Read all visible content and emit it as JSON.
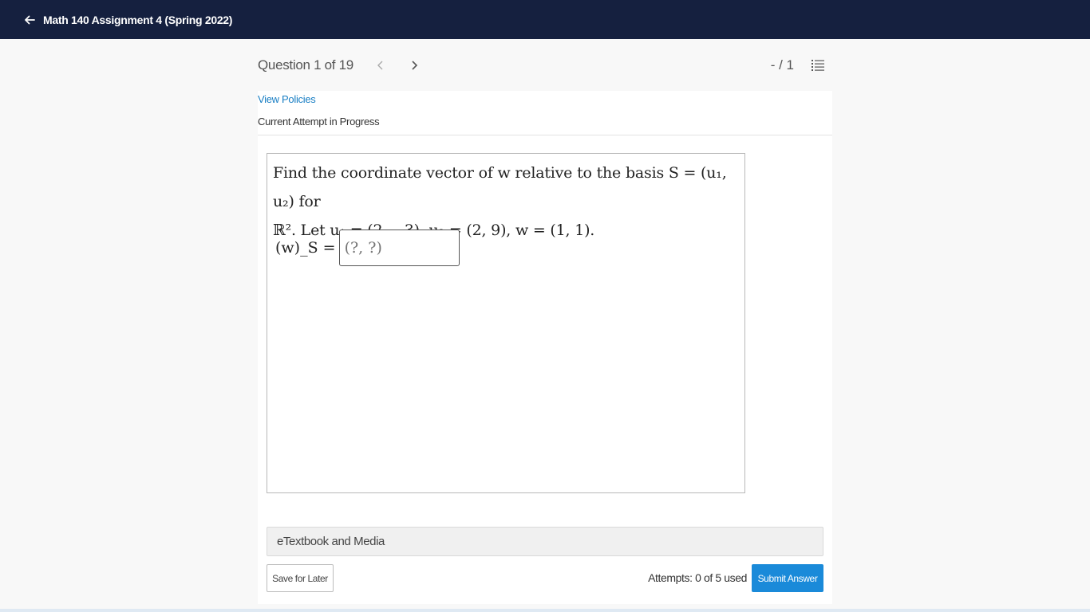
{
  "header": {
    "title": "Math 140 Assignment 4 (Spring 2022)",
    "back_icon": "arrow-left-icon"
  },
  "question_nav": {
    "counter": "Question 1 of 19",
    "score": "- / 1"
  },
  "policies_link": "View Policies",
  "attempt_status": "Current Attempt in Progress",
  "question": {
    "line1": "Find the coordinate vector of w relative to the basis S = (u₁, u₂) for",
    "line2": "ℝ². Let u₁ = (2, −3), u₂ = (2, 9), w = (1, 1).",
    "answer_label": "(w)_S =",
    "answer_placeholder": "(?, ?)"
  },
  "etextbook_label": "eTextbook and Media",
  "footer": {
    "save_label": "Save for Later",
    "attempts_text": "Attempts: 0 of 5 used",
    "submit_label": "Submit Answer"
  },
  "colors": {
    "header_bg": "#15203f",
    "link": "#1a7fc4",
    "submit_bg": "#1a8ad9"
  }
}
